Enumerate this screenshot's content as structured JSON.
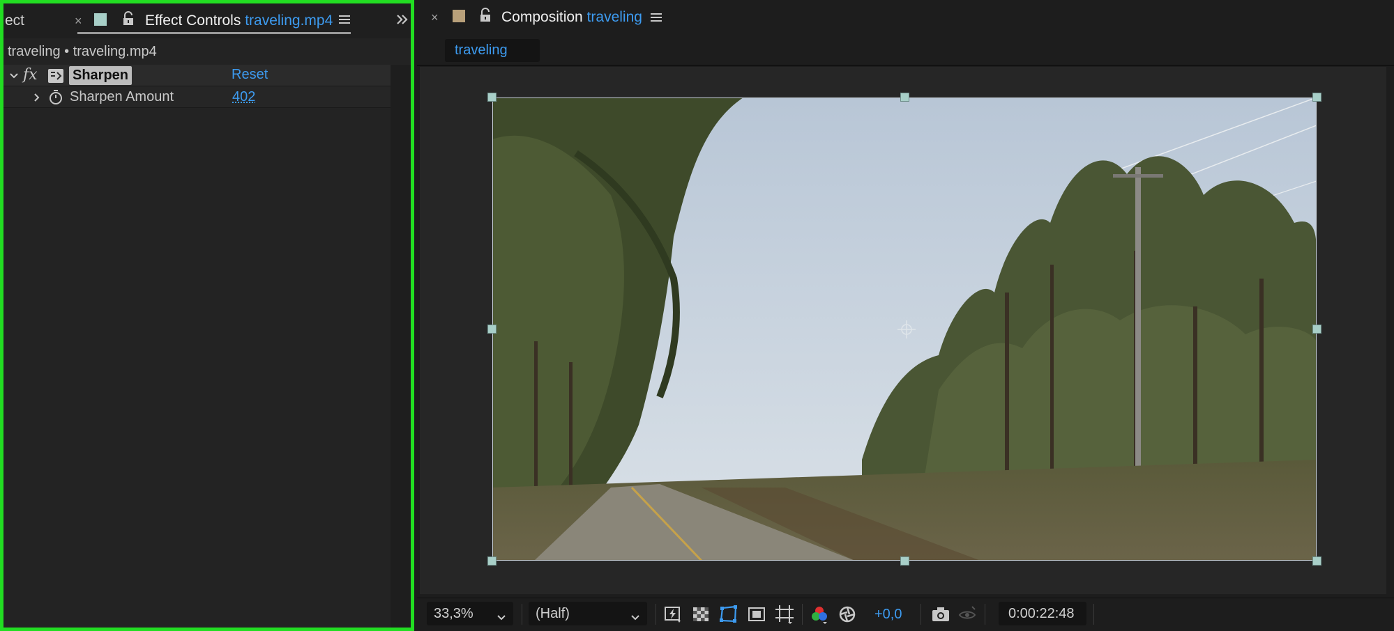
{
  "left_panel": {
    "partial_tab_label": "ect",
    "tab_title": "Effect Controls",
    "tab_file": "traveling.mp4",
    "subtitle": "traveling • traveling.mp4",
    "effect": {
      "name": "Sharpen",
      "reset_label": "Reset",
      "property_label": "Sharpen Amount",
      "property_value": "402"
    }
  },
  "right_panel": {
    "tab_title": "Composition",
    "tab_comp": "traveling",
    "subtab_label": "traveling"
  },
  "toolbar": {
    "zoom": "33,3%",
    "resolution": "(Half)",
    "exposure": "+0,0",
    "timecode": "0:00:22:48"
  },
  "colors": {
    "accent_blue": "#3d9bf0",
    "panel_highlight_green": "#22dd22",
    "effect_label_swatch": "#a8cfc8",
    "composition_label_swatch": "#b8a07a"
  },
  "icons": [
    "close-icon",
    "label-color-swatch",
    "lock-icon",
    "panel-menu-icon",
    "panel-overflow-icon",
    "chevron-down-icon",
    "chevron-right-icon",
    "fx-icon",
    "effect-preset-icon",
    "stopwatch-icon",
    "fast-previews-icon",
    "transparency-grid-icon",
    "mask-visibility-icon",
    "region-of-interest-icon",
    "guides-icon",
    "channel-icon",
    "color-management-icon",
    "camera-icon",
    "show-snapshot-icon"
  ]
}
